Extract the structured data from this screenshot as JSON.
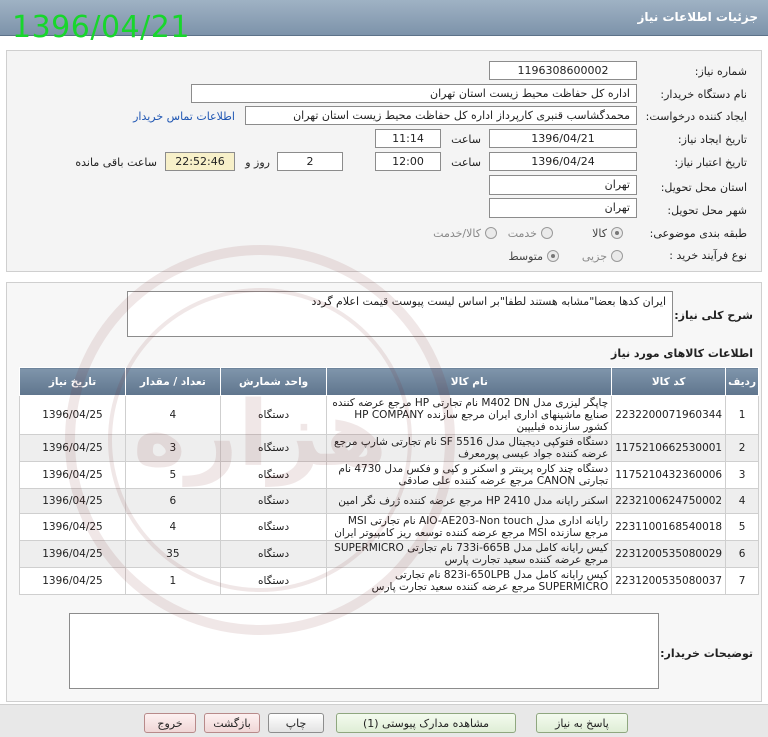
{
  "header": {
    "title": "جزئیات اطلاعات نیاز",
    "big_date": "1396/04/21"
  },
  "form": {
    "need_number_label": "شماره نیاز:",
    "need_number": "1196308600002",
    "buyer_org_label": "نام دستگاه خریدار:",
    "buyer_org": "اداره کل حفاظت محیط زیست استان تهران",
    "creator_label": "ایجاد کننده درخواست:",
    "creator": "محمدگشاسب قنبری کارپرداز اداره کل حفاظت محیط زیست استان تهران",
    "contact_link": "اطلاعات تماس خریدار",
    "created_date_label": "تاریخ ایجاد نیاز:",
    "created_date": "1396/04/21",
    "time_label": "ساعت",
    "created_time": "11:14",
    "valid_date_label": "تاریخ اعتبار نیاز:",
    "valid_date": "1396/04/24",
    "valid_time": "12:00",
    "days": "2",
    "days_label": "روز و",
    "remaining_time": "22:52:46",
    "remaining_label": "ساعت باقی مانده",
    "province_label": "استان محل تحویل:",
    "province": "تهران",
    "city_label": "شهر محل تحویل:",
    "city": "تهران",
    "category_label": "طبقه بندی موضوعی:",
    "category_options": [
      "کالا",
      "خدمت",
      "کالا/خدمت"
    ],
    "purchase_type_label": "نوع فرآیند خرید :",
    "purchase_type_options": [
      "جزیی",
      "متوسط"
    ]
  },
  "description": {
    "label": "شرح کلی نیاز:",
    "text": "ایران کدها بعضا\"مشابه هستند لطفا\"بر اساس لیست پیوست قیمت اعلام گردد"
  },
  "items": {
    "section_title": "اطلاعات کالاهای مورد نیاز",
    "headers": [
      "ردیف",
      "کد کالا",
      "نام کالا",
      "واحد شمارش",
      "تعداد / مقدار",
      "تاریخ نیاز"
    ],
    "rows": [
      {
        "row": "1",
        "code": "2232200071960344",
        "name": "چاپگر لیزری مدل M402 DN نام تجارتی HP مرجع عرضه کننده صنایع ماشینهای اداری ایران مرجع سازنده HP COMPANY کشور سازنده فیلیپین",
        "unit": "دستگاه",
        "qty": "4",
        "date": "1396/04/25"
      },
      {
        "row": "2",
        "code": "1175210662530001",
        "name": "دستگاه فتوکپی دیجیتال مدل SF 5516 نام تجارتی شارپ مرجع عرضه کننده جواد عیسی پورمعرف",
        "unit": "دستگاه",
        "qty": "3",
        "date": "1396/04/25"
      },
      {
        "row": "3",
        "code": "1175210432360006",
        "name": "دستگاه چند کاره پرینتر و اسکنر و کپی و فکس مدل 4730 نام تجارتی CANON مرجع عرضه کننده علی صادقی",
        "unit": "دستگاه",
        "qty": "5",
        "date": "1396/04/25"
      },
      {
        "row": "4",
        "code": "2232100624750002",
        "name": "اسکنر رایانه مدل HP 2410 مرجع عرضه کننده ژرف نگر امین",
        "unit": "دستگاه",
        "qty": "6",
        "date": "1396/04/25"
      },
      {
        "row": "5",
        "code": "2231100168540018",
        "name": "رایانه اداری مدل AIO-AE203-Non touch نام تجارتی MSI مرجع سازنده MSI مرجع عرضه کننده توسعه ریز کامپیوتر ایران",
        "unit": "دستگاه",
        "qty": "4",
        "date": "1396/04/25"
      },
      {
        "row": "6",
        "code": "2231200535080029",
        "name": "کیس رایانه کامل مدل 733i-665B نام تجارتی SUPERMICRO مرجع عرضه کننده سعید تجارت پارس",
        "unit": "دستگاه",
        "qty": "35",
        "date": "1396/04/25"
      },
      {
        "row": "7",
        "code": "2231200535080037",
        "name": "کیس رایانه کامل مدل 823i-650LPB نام تجارتی SUPERMICRO مرجع عرضه کننده سعید تجارت پارس",
        "unit": "دستگاه",
        "qty": "1",
        "date": "1396/04/25"
      }
    ]
  },
  "notes": {
    "label": "توضیحات خریدار:"
  },
  "buttons": {
    "reply": "پاسخ به نیاز",
    "attachments": "مشاهده مدارک پیوستی (1)",
    "print": "چاپ",
    "back": "بازگشت",
    "exit": "خروج"
  },
  "watermark": {
    "text": "هزاره"
  }
}
